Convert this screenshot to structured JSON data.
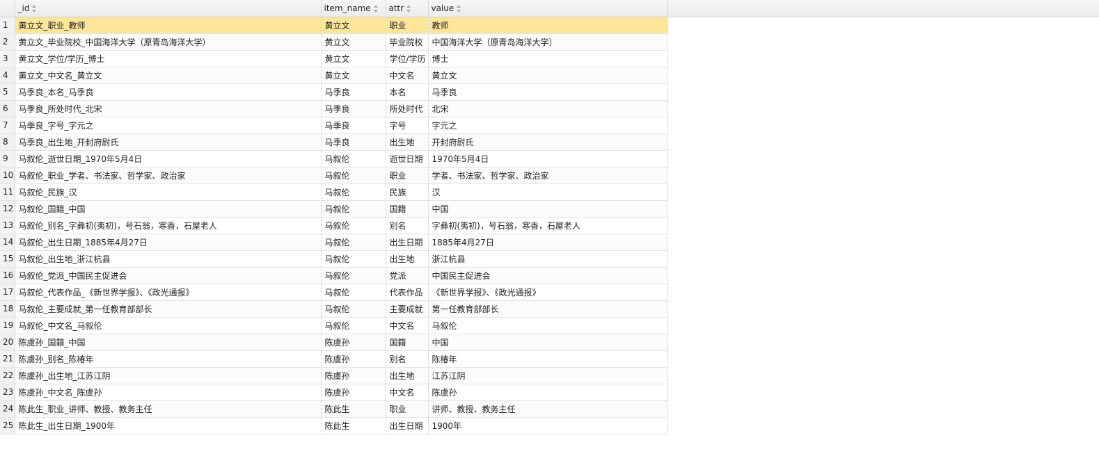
{
  "columns": [
    {
      "label": "",
      "sortable": false
    },
    {
      "label": "_id",
      "sortable": true
    },
    {
      "label": "item_name",
      "sortable": true
    },
    {
      "label": "attr",
      "sortable": true
    },
    {
      "label": "value",
      "sortable": true
    }
  ],
  "selected_row": 1,
  "highlight_color": "#fde59a",
  "rows": [
    {
      "num": "1",
      "id": "黄立文_职业_教师",
      "item_name": "黄立文",
      "attr": "职业",
      "value": "教师"
    },
    {
      "num": "2",
      "id": "黄立文_毕业院校_中国海洋大学（原青岛海洋大学）",
      "item_name": "黄立文",
      "attr": "毕业院校",
      "value": "中国海洋大学（原青岛海洋大学）"
    },
    {
      "num": "3",
      "id": "黄立文_学位/学历_博士",
      "item_name": "黄立文",
      "attr": "学位/学历",
      "value": "博士"
    },
    {
      "num": "4",
      "id": "黄立文_中文名_黄立文",
      "item_name": "黄立文",
      "attr": "中文名",
      "value": "黄立文"
    },
    {
      "num": "5",
      "id": "马季良_本名_马季良",
      "item_name": "马季良",
      "attr": "本名",
      "value": "马季良"
    },
    {
      "num": "6",
      "id": "马季良_所处时代_北宋",
      "item_name": "马季良",
      "attr": "所处时代",
      "value": "北宋"
    },
    {
      "num": "7",
      "id": "马季良_字号_字元之",
      "item_name": "马季良",
      "attr": "字号",
      "value": "字元之"
    },
    {
      "num": "8",
      "id": "马季良_出生地_开封府尉氏",
      "item_name": "马季良",
      "attr": "出生地",
      "value": "开封府尉氏"
    },
    {
      "num": "9",
      "id": "马叙伦_逝世日期_1970年5月4日",
      "item_name": "马叙伦",
      "attr": "逝世日期",
      "value": "1970年5月4日"
    },
    {
      "num": "10",
      "id": "马叙伦_职业_学者、书法家、哲学家、政治家",
      "item_name": "马叙伦",
      "attr": "职业",
      "value": "学者、书法家、哲学家、政治家"
    },
    {
      "num": "11",
      "id": "马叙伦_民族_汉",
      "item_name": "马叙伦",
      "attr": "民族",
      "value": "汉"
    },
    {
      "num": "12",
      "id": "马叙伦_国籍_中国",
      "item_name": "马叙伦",
      "attr": "国籍",
      "value": "中国"
    },
    {
      "num": "13",
      "id": "马叙伦_别名_字彝初(夷初)，号石翁，寒香，石屋老人",
      "item_name": "马叙伦",
      "attr": "别名",
      "value": "字彝初(夷初)，号石翁，寒香，石屋老人"
    },
    {
      "num": "14",
      "id": "马叙伦_出生日期_1885年4月27日",
      "item_name": "马叙伦",
      "attr": "出生日期",
      "value": "1885年4月27日"
    },
    {
      "num": "15",
      "id": "马叙伦_出生地_浙江杭县",
      "item_name": "马叙伦",
      "attr": "出生地",
      "value": "浙江杭县"
    },
    {
      "num": "16",
      "id": "马叙伦_党派_中国民主促进会",
      "item_name": "马叙伦",
      "attr": "党派",
      "value": "中国民主促进会"
    },
    {
      "num": "17",
      "id": "马叙伦_代表作品_《新世界学报》、《政光通报》",
      "item_name": "马叙伦",
      "attr": "代表作品",
      "value": "《新世界学报》、《政光通报》"
    },
    {
      "num": "18",
      "id": "马叙伦_主要成就_第一任教育部部长",
      "item_name": "马叙伦",
      "attr": "主要成就",
      "value": "第一任教育部部长"
    },
    {
      "num": "19",
      "id": "马叙伦_中文名_马叙伦",
      "item_name": "马叙伦",
      "attr": "中文名",
      "value": "马叙伦"
    },
    {
      "num": "20",
      "id": "陈虞孙_国籍_中国",
      "item_name": "陈虞孙",
      "attr": "国籍",
      "value": "中国"
    },
    {
      "num": "21",
      "id": "陈虞孙_别名_陈椿年",
      "item_name": "陈虞孙",
      "attr": "别名",
      "value": "陈椿年"
    },
    {
      "num": "22",
      "id": "陈虞孙_出生地_江苏江阴",
      "item_name": "陈虞孙",
      "attr": "出生地",
      "value": "江苏江阴"
    },
    {
      "num": "23",
      "id": "陈虞孙_中文名_陈虞孙",
      "item_name": "陈虞孙",
      "attr": "中文名",
      "value": "陈虞孙"
    },
    {
      "num": "24",
      "id": "陈此生_职业_讲师、教授、教务主任",
      "item_name": "陈此生",
      "attr": "职业",
      "value": "讲师、教授、教务主任"
    },
    {
      "num": "25",
      "id": "陈此生_出生日期_1900年",
      "item_name": "陈此生",
      "attr": "出生日期",
      "value": "1900年"
    }
  ]
}
